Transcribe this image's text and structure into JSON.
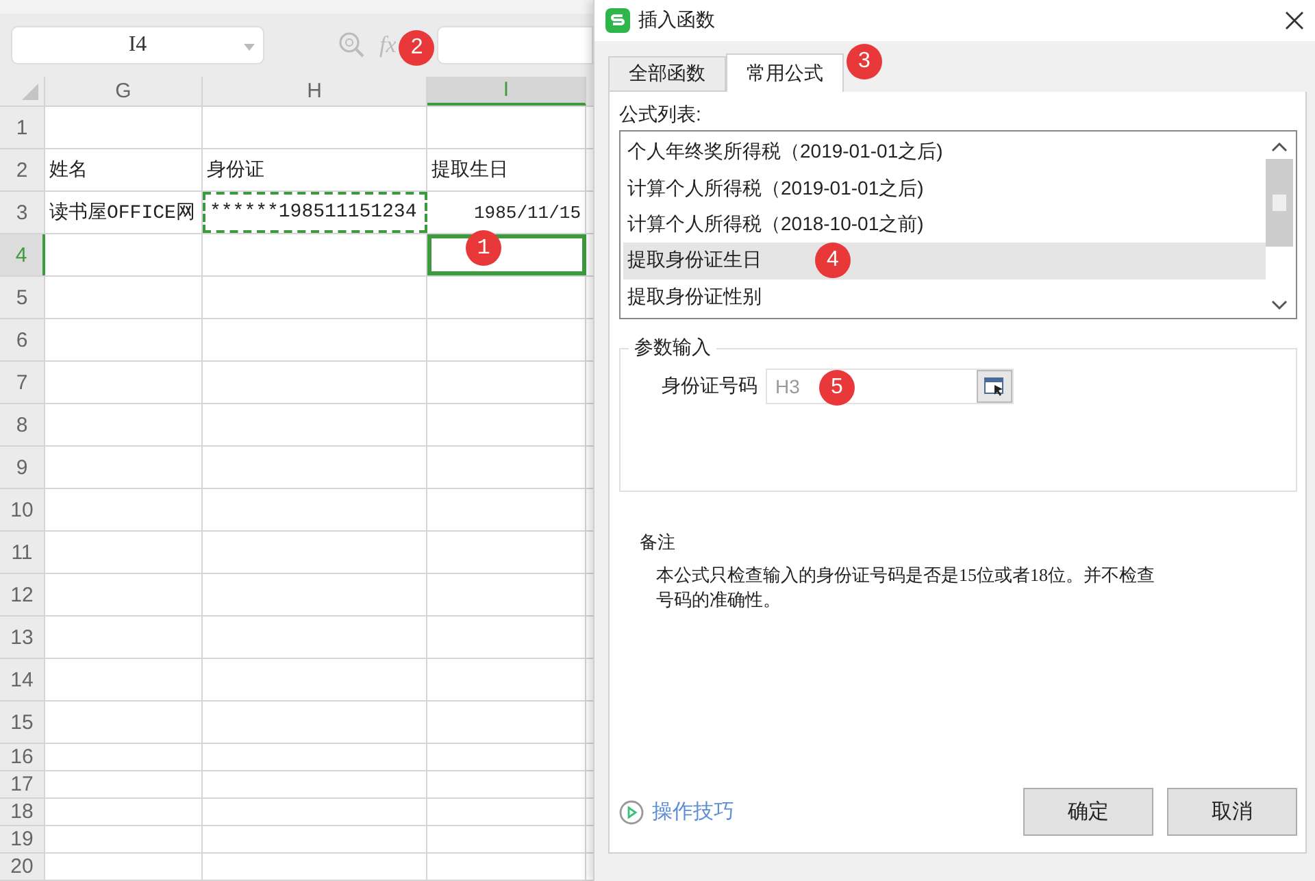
{
  "name_box": {
    "value": "I4"
  },
  "formula_bar": {
    "icon": "fx",
    "badge": "2"
  },
  "columns": [
    {
      "label": "G",
      "selected": false
    },
    {
      "label": "H",
      "selected": false
    },
    {
      "label": "I",
      "selected": true
    }
  ],
  "rows": [
    {
      "number": "1",
      "selected": false
    },
    {
      "number": "2",
      "selected": false,
      "cells": [
        {
          "text": "姓名",
          "kind": "text",
          "copied": false
        },
        {
          "text": "身份证",
          "kind": "text",
          "copied": false
        },
        {
          "text": "提取生日",
          "kind": "text",
          "copied": false
        }
      ]
    },
    {
      "number": "3",
      "selected": false,
      "cells": [
        {
          "text": "读书屋OFFICE网",
          "kind": "text",
          "copied": false
        },
        {
          "text": "******198511151234",
          "kind": "text",
          "copied": true
        },
        {
          "text": "1985/11/15",
          "kind": "date",
          "copied": false
        }
      ]
    },
    {
      "number": "4",
      "selected": true,
      "badge": "1"
    },
    {
      "number": "5",
      "selected": false
    },
    {
      "number": "6",
      "selected": false
    },
    {
      "number": "7",
      "selected": false
    },
    {
      "number": "8",
      "selected": false
    },
    {
      "number": "9",
      "selected": false
    },
    {
      "number": "10",
      "selected": false
    },
    {
      "number": "11",
      "selected": false
    },
    {
      "number": "12",
      "selected": false
    },
    {
      "number": "13",
      "selected": false
    },
    {
      "number": "14",
      "selected": false
    },
    {
      "number": "15",
      "selected": false
    },
    {
      "number": "16",
      "selected": false
    },
    {
      "number": "17",
      "selected": false
    },
    {
      "number": "18",
      "selected": false
    },
    {
      "number": "19",
      "selected": false
    },
    {
      "number": "20",
      "selected": false
    }
  ],
  "dialog": {
    "title": "插入函数",
    "tabs": [
      {
        "label": "全部函数",
        "selected": false
      },
      {
        "label": "常用公式",
        "selected": true,
        "badge": "3"
      }
    ],
    "list_label": "公式列表:",
    "formulas": [
      {
        "label": "个人年终奖所得税（2019-01-01之后)",
        "selected": false
      },
      {
        "label": "计算个人所得税（2019-01-01之后)",
        "selected": false
      },
      {
        "label": "计算个人所得税（2018-10-01之前)",
        "selected": false
      },
      {
        "label": "提取身份证生日",
        "selected": true,
        "badge": "4"
      },
      {
        "label": "提取身份证性别",
        "selected": false
      }
    ],
    "params_legend": "参数输入",
    "param": {
      "label": "身份证号码",
      "value": "H3",
      "badge": "5"
    },
    "note_title": "备注",
    "note": "本公式只检查输入的身份证号码是否是15位或者18位。并不检查号码的准确性。",
    "tips_link": "操作技巧",
    "buttons": [
      "确定",
      "取消"
    ]
  }
}
